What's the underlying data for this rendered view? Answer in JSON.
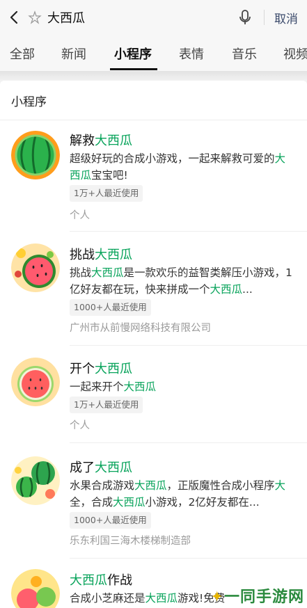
{
  "search": {
    "query": "大西瓜",
    "cancel_label": "取消"
  },
  "tabs": [
    "全部",
    "新闻",
    "小程序",
    "表情",
    "音乐",
    "视频"
  ],
  "section": {
    "title": "小程序"
  },
  "items": [
    {
      "title_pre": "解救",
      "title_hl": "大西瓜",
      "title_post": "",
      "desc": [
        {
          "t": "超级好玩的合成小游戏，一起来解救可爱的",
          "hl": false
        },
        {
          "t": "大西瓜",
          "hl": true
        },
        {
          "t": "宝宝吧!",
          "hl": false
        }
      ],
      "badge": "1万+人最近使用",
      "owner": "个人"
    },
    {
      "title_pre": "挑战",
      "title_hl": "大西瓜",
      "title_post": "",
      "desc": [
        {
          "t": "挑战",
          "hl": false
        },
        {
          "t": "大西瓜",
          "hl": true
        },
        {
          "t": "是一款欢乐的益智类解压小游戏，1亿好友都在玩，快来拼成一个",
          "hl": false
        },
        {
          "t": "大西瓜",
          "hl": true
        },
        {
          "t": "...",
          "hl": false
        }
      ],
      "badge": "1000+人最近使用",
      "owner": "广州市从前慢网络科技有限公司"
    },
    {
      "title_pre": "开个",
      "title_hl": "大西瓜",
      "title_post": "",
      "desc": [
        {
          "t": "一起来开个",
          "hl": false
        },
        {
          "t": "大西瓜",
          "hl": true
        }
      ],
      "badge": "1万+人最近使用",
      "owner": "个人"
    },
    {
      "title_pre": "成了",
      "title_hl": "大西瓜",
      "title_post": "",
      "desc": [
        {
          "t": "水果合成游戏",
          "hl": false
        },
        {
          "t": "大西瓜",
          "hl": true
        },
        {
          "t": "，正版魔性合成小程序",
          "hl": false
        },
        {
          "t": "大",
          "hl": true
        },
        {
          "t": "全，合成",
          "hl": false
        },
        {
          "t": "大西瓜",
          "hl": true
        },
        {
          "t": "小游戏，2亿好友都在...",
          "hl": false
        }
      ],
      "badge": "1000+人最近使用",
      "owner": "乐东利国三海木楼梯制造部"
    },
    {
      "title_pre": "",
      "title_hl": "大西瓜",
      "title_post": "作战",
      "desc": [
        {
          "t": "合成小芝麻还是",
          "hl": false
        },
        {
          "t": "大西瓜",
          "hl": true
        },
        {
          "t": "游戏!免费",
          "hl": false
        }
      ],
      "badge": "",
      "owner": ""
    }
  ],
  "watermark": {
    "text": "一同手游网"
  },
  "colors": {
    "highlight": "#07a35a",
    "cancel": "#3b4a6b"
  }
}
